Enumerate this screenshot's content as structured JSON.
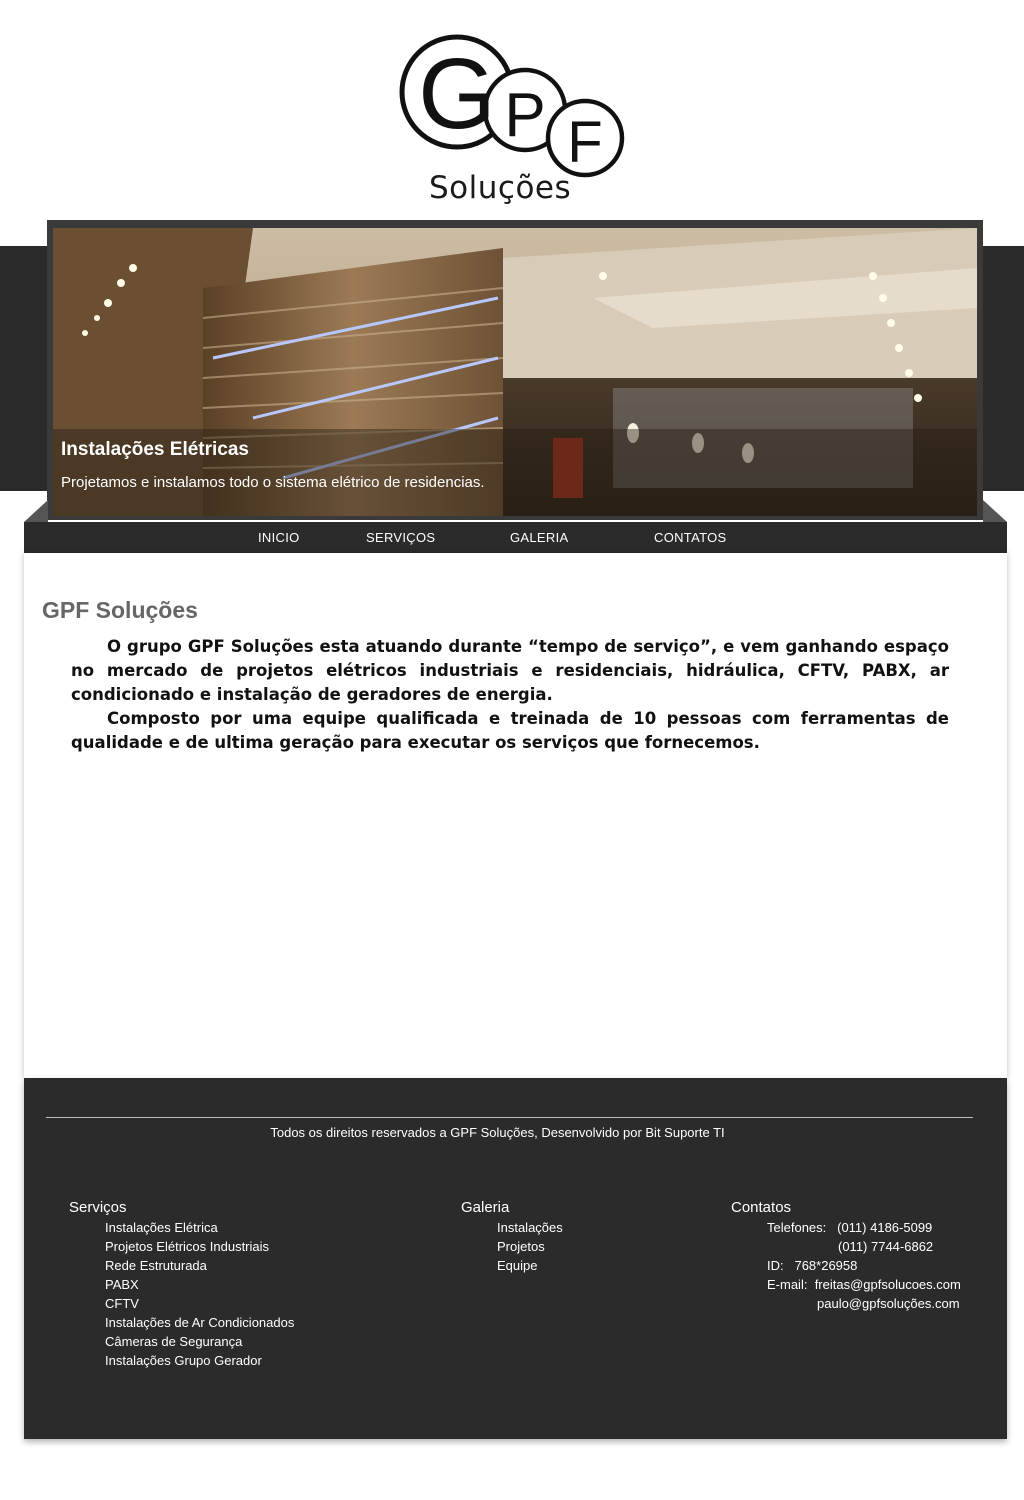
{
  "logo": {
    "letters": [
      "G",
      "P",
      "F"
    ],
    "text": "Soluções"
  },
  "hero": {
    "title": "Instalações Elétricas",
    "subtitle": "Projetamos e instalamos todo o sistema elétrico de residencias."
  },
  "nav": {
    "items": [
      "INICIO",
      "SERVIÇOS",
      "GALERIA",
      "CONTATOS"
    ]
  },
  "content": {
    "title": "GPF Soluções",
    "paragraphs": [
      "O grupo GPF Soluções esta atuando durante “tempo de serviço”, e vem ganhando espaço no mercado de projetos elétricos industriais e residenciais, hidráulica, CFTV, PABX, ar condicionado e instalação de geradores de energia.",
      "Composto por uma equipe qualificada e treinada de 10 pessoas com ferramentas de qualidade e de ultima geração para executar os serviços que fornecemos."
    ]
  },
  "footer": {
    "copyright": "Todos os direitos reservados a GPF Soluções, Desenvolvido por Bit Suporte TI",
    "services": {
      "title": "Serviços",
      "items": [
        "Instalações Elétrica",
        "Projetos Elétricos Industriais",
        "Rede Estruturada",
        "PABX",
        "CFTV",
        "Instalações de Ar Condicionados",
        "Câmeras de Segurança",
        "Instalações Grupo Gerador"
      ]
    },
    "gallery": {
      "title": "Galeria",
      "items": [
        "Instalações",
        "Projetos",
        "Equipe"
      ]
    },
    "contacts": {
      "title": "Contatos",
      "phones_label": "Telefones:",
      "phone1": "(011) 4186-5099",
      "phone2": "(011) 7744-6862",
      "id_label": "ID:",
      "id_value": "768*26958",
      "email_label": "E-mail:",
      "email1": "freitas@gpfsolucoes.com",
      "email2": "paulo@gpfsoluções.com"
    }
  },
  "colors": {
    "dark": "#2b2b2b",
    "frame": "#3a3a3a",
    "title_gray": "#666666"
  }
}
